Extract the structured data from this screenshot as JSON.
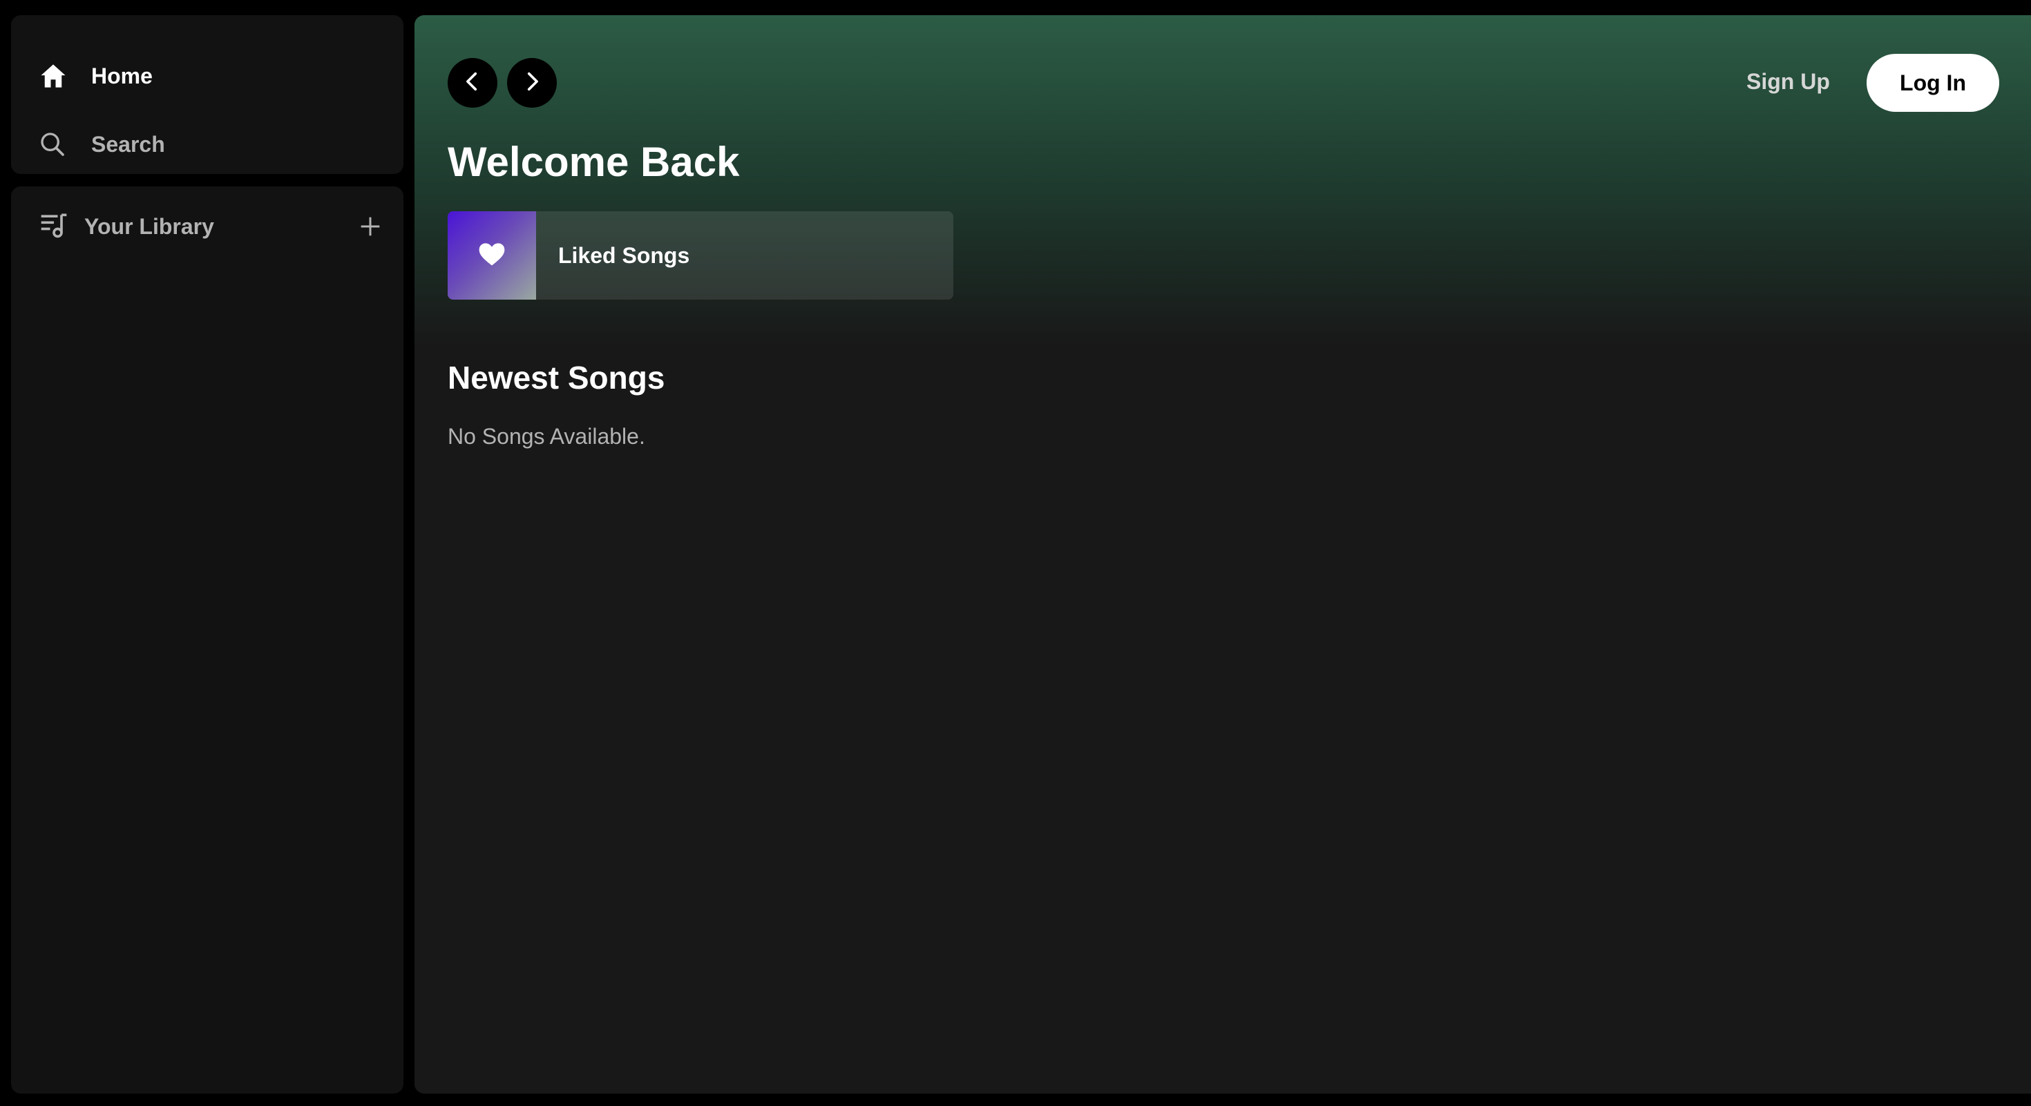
{
  "sidebar": {
    "nav": [
      {
        "label": "Home",
        "icon": "home-icon"
      },
      {
        "label": "Search",
        "icon": "search-icon"
      }
    ],
    "library": {
      "label": "Your Library",
      "icon": "library-icon",
      "add_icon": "plus-icon"
    }
  },
  "header": {
    "back_icon": "chevron-left-icon",
    "forward_icon": "chevron-right-icon",
    "signup_label": "Sign Up",
    "login_label": "Log In"
  },
  "main": {
    "welcome_title": "Welcome Back",
    "liked_songs": {
      "label": "Liked Songs",
      "icon": "heart-icon"
    },
    "newest_title": "Newest Songs",
    "empty_message": "No Songs Available."
  },
  "colors": {
    "accent_green": "#2c5c45",
    "background": "#121212",
    "liked_gradient_start": "#4a14d6"
  }
}
